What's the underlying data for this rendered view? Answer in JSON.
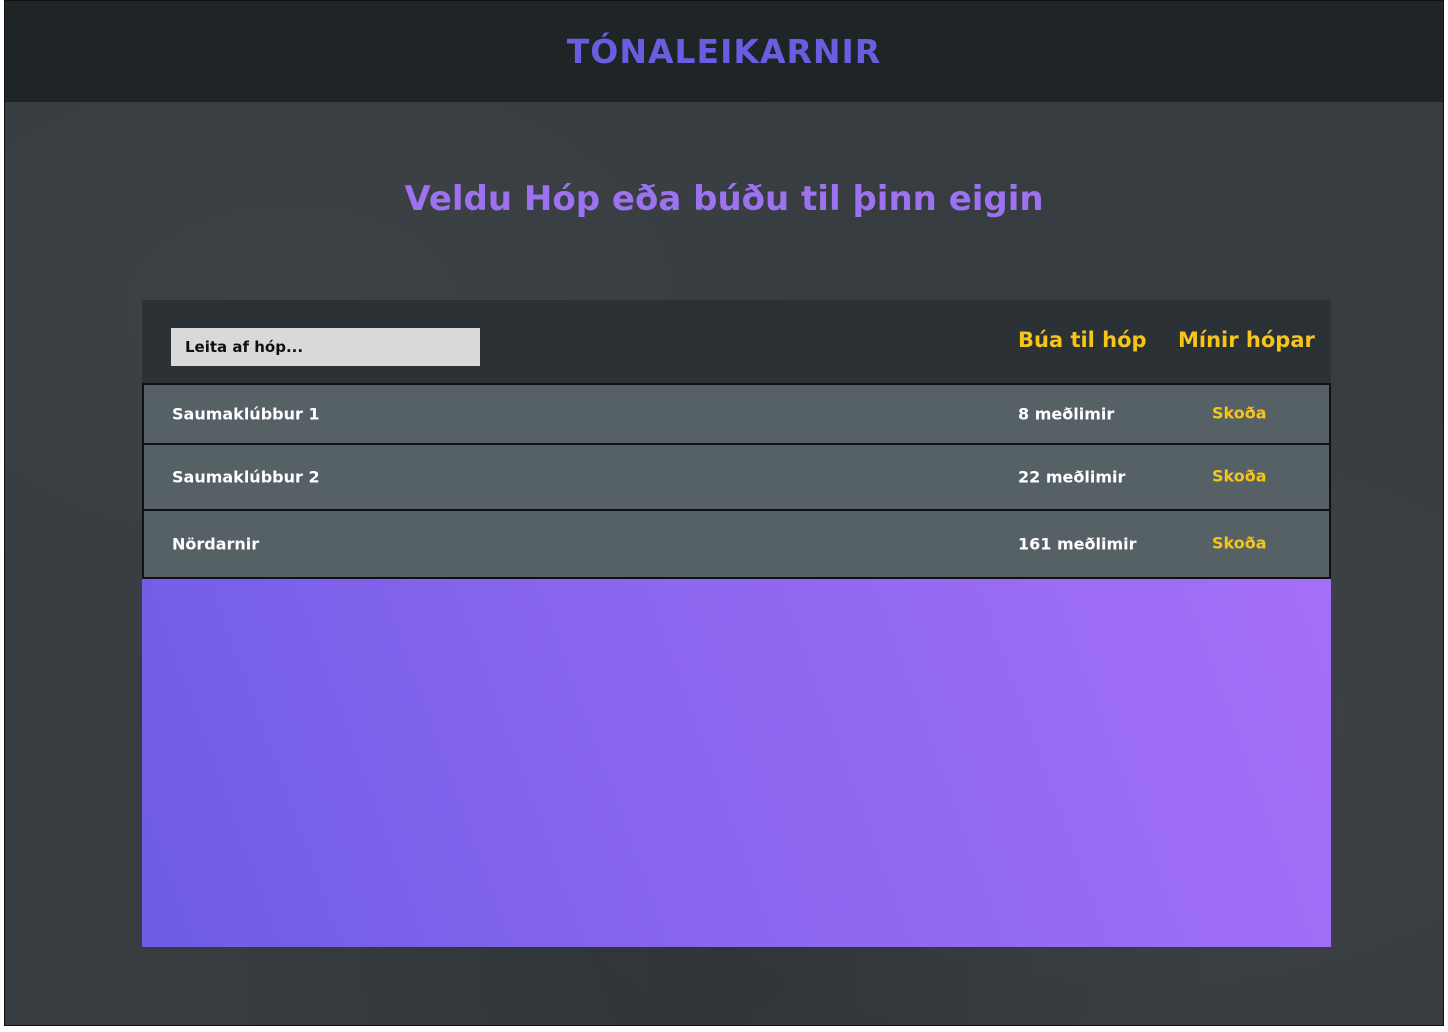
{
  "header": {
    "brand": "TÓNALEIKARNIR"
  },
  "main": {
    "headline": "Veldu Hóp eða búðu til þinn eigin"
  },
  "toolbar": {
    "search_placeholder": "Leita af hóp...",
    "create_group_label": "Búa til hóp",
    "my_groups_label": "Mínir hópar"
  },
  "groups": [
    {
      "name": "Saumaklúbbur 1",
      "members": "8 meðlimir",
      "action": "Skoða"
    },
    {
      "name": "Saumaklúbbur 2",
      "members": "22 meðlimir",
      "action": "Skoða"
    },
    {
      "name": "Nördarnir",
      "members": "161 meðlimir",
      "action": "Skoða"
    }
  ],
  "colors": {
    "brand": "#6a5ee0",
    "headline": "#9d72f0",
    "accent": "#f5c518",
    "row_background": "#566166",
    "gradient_start": "#6e5ce6",
    "gradient_end": "#a56ff7"
  }
}
